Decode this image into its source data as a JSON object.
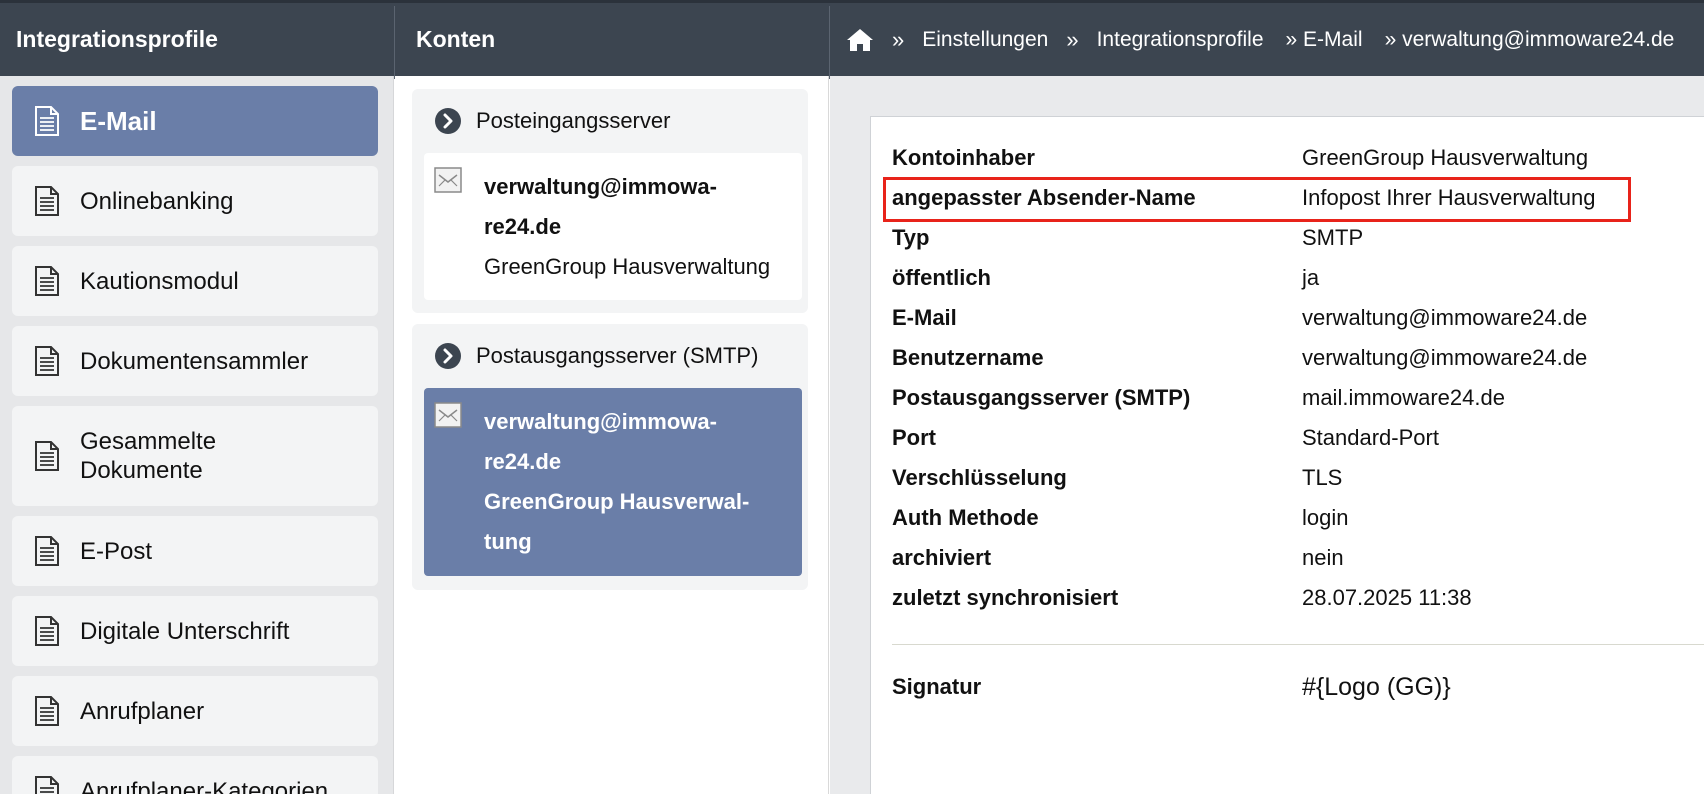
{
  "header": {
    "col1_title": "Integrationsprofile",
    "col2_title": "Konten",
    "breadcrumb": {
      "sep": "»",
      "items": [
        "Einstellungen",
        "Integrationsprofile",
        "» E-Mail",
        "» verwaltung@immoware24.de"
      ]
    }
  },
  "sidebar": {
    "items": [
      {
        "label": "E-Mail",
        "active": true
      },
      {
        "label": "Onlinebanking"
      },
      {
        "label": "Kautionsmodul"
      },
      {
        "label": "Dokumentensammler"
      },
      {
        "label_line1": "Gesammelte",
        "label_line2": "Dokumente"
      },
      {
        "label": "E-Post"
      },
      {
        "label": "Digitale Unterschrift"
      },
      {
        "label": "Anrufplaner"
      },
      {
        "label": "Anrufplaner-Kategorien"
      }
    ]
  },
  "konten": {
    "incoming": {
      "title": "Posteingangsserver",
      "account": {
        "line1": "verwaltung@immowa-",
        "line2": "re24.de",
        "line3": "GreenGroup Hausverwaltung"
      }
    },
    "outgoing": {
      "title": "Postausgangsserver (SMTP)",
      "account": {
        "line1": "verwaltung@immowa-",
        "line2": "re24.de",
        "line3": "GreenGroup Hausverwal-",
        "line4": "tung"
      }
    }
  },
  "details": {
    "rows": [
      {
        "key": "Kontoinhaber",
        "value": "GreenGroup Hausverwaltung"
      },
      {
        "key": "angepasster Absender-Name",
        "value": "Infopost Ihrer Hausverwaltung"
      },
      {
        "key": "Typ",
        "value": "SMTP"
      },
      {
        "key": "öffentlich",
        "value": "ja"
      },
      {
        "key": "E-Mail",
        "value": "verwaltung@immoware24.de"
      },
      {
        "key": "Benutzername",
        "value": "verwaltung@immoware24.de"
      },
      {
        "key": "Postausgangsserver (SMTP)",
        "value": "mail.immoware24.de"
      },
      {
        "key": "Port",
        "value": "Standard-Port"
      },
      {
        "key": "Verschlüsselung",
        "value": "TLS"
      },
      {
        "key": "Auth Methode",
        "value": "login"
      },
      {
        "key": "archiviert",
        "value": "nein"
      },
      {
        "key": "zuletzt synchronisiert",
        "value": "28.07.2025 11:38"
      }
    ],
    "signature": {
      "key": "Signatur",
      "value": "#{Logo (GG)}"
    }
  },
  "colors": {
    "header_bg": "#3c4550",
    "active_bg": "#6a7ea8",
    "highlight": "#e8231a"
  }
}
